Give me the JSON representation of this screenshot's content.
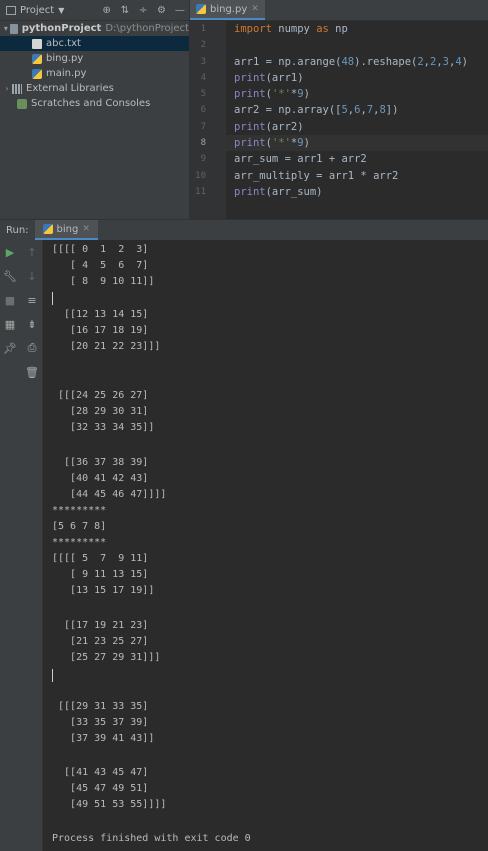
{
  "project_panel": {
    "title": "Project",
    "tree": [
      {
        "label": "pythonProject",
        "path": "D:\\pythonProject"
      },
      {
        "label": "abc.txt"
      },
      {
        "label": "bing.py"
      },
      {
        "label": "main.py"
      },
      {
        "label": "External Libraries"
      },
      {
        "label": "Scratches and Consoles"
      }
    ]
  },
  "editor": {
    "tab": "bing.py",
    "line_numbers": [
      "1",
      "2",
      "3",
      "4",
      "5",
      "6",
      "7",
      "8",
      "9",
      "10",
      "11"
    ],
    "current_line": 8
  },
  "run": {
    "label": "Run:",
    "tab": "bing",
    "output": [
      "[[[[ 0  1  2  3]",
      "   [ 4  5  6  7]",
      "   [ 8  9 10 11]]",
      "",
      "  [[12 13 14 15]",
      "   [16 17 18 19]",
      "   [20 21 22 23]]]",
      "",
      "",
      "",
      " [[[24 25 26 27]",
      "   [28 29 30 31]",
      "   [32 33 34 35]]",
      "",
      "  [[36 37 38 39]",
      "   [40 41 42 43]",
      "   [44 45 46 47]]]]",
      "*********",
      "[5 6 7 8]",
      "*********",
      "[[[[ 5  7  9 11]",
      "   [ 9 11 13 15]",
      "   [13 15 17 19]]",
      "",
      "  [[17 19 21 23]",
      "   [21 23 25 27]",
      "   [25 27 29 31]]]",
      "",
      "",
      "",
      " [[[29 31 33 35]",
      "   [33 35 37 39]",
      "   [37 39 41 43]]",
      "",
      "  [[41 43 45 47]",
      "   [45 47 49 51]",
      "   [49 51 53 55]]]]",
      "",
      "Process finished with exit code 0"
    ]
  }
}
